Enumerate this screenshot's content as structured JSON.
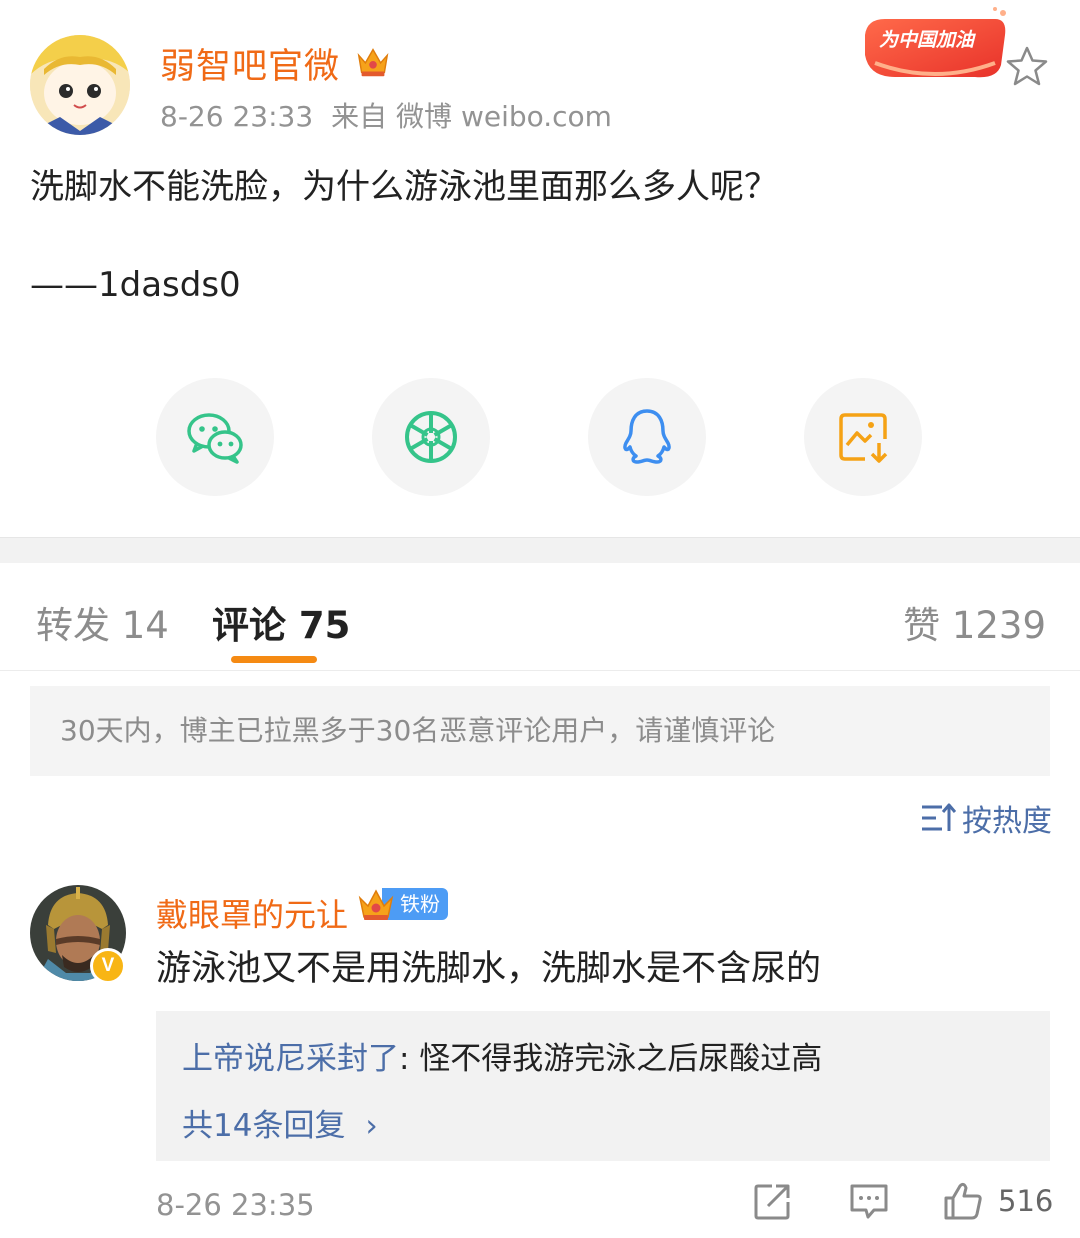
{
  "post": {
    "author": "弱智吧官微",
    "time": "8-26 23:33",
    "source": "来自 微博 weibo.com",
    "body": "洗脚水不能洗脸，为什么游泳池里面那么多人呢？",
    "signature": "——1dasds0",
    "badge_text": "为中国加油"
  },
  "share_icons": [
    "wechat-icon",
    "moments-icon",
    "qq-icon",
    "save-image-icon"
  ],
  "tabs": {
    "repost": "转发 14",
    "comment": "评论 75",
    "like": "赞 1239"
  },
  "notice": "30天内，博主已拉黑多于30名恶意评论用户，请谨慎评论",
  "sort_label": "按热度",
  "comment": {
    "user": "戴眼罩的元让",
    "fan_badge": "铁粉",
    "verified_mark": "V",
    "text": "游泳池又不是用洗脚水，洗脚水是不含尿的",
    "reply": {
      "user": "上帝说尼采封了",
      "separator": ":",
      "text": " 怪不得我游完泳之后尿酸过高",
      "more": "共14条回复",
      "more_arrow": "›"
    },
    "time": "8-26 23:35",
    "like_count": "516"
  },
  "colors": {
    "accent": "#f06a16",
    "link": "#4c6ea8",
    "tab_indicator": "#f58a13"
  }
}
